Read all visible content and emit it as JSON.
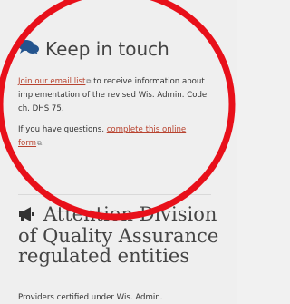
{
  "keep_in_touch": {
    "title": "Keep in touch",
    "email_link": "Join our email list",
    "email_text": " to receive information about implementation of the revised Wis. Admin. Code ch. DHS 75.",
    "questions_text": "If you have questions, ",
    "form_link": "complete this online form",
    "period": ".",
    "icon": "speech-bubbles-icon",
    "external_icon": "external-link-icon"
  },
  "attention": {
    "title_line1": "Attention Division",
    "title_line2": "of Quality Assurance",
    "title_line3": "regulated entities",
    "icon": "megaphone-icon"
  },
  "providers_text": "Providers certified under Wis. Admin.",
  "colors": {
    "link": "#b8432f",
    "annotation": "#e8101a",
    "heading": "#444444"
  }
}
